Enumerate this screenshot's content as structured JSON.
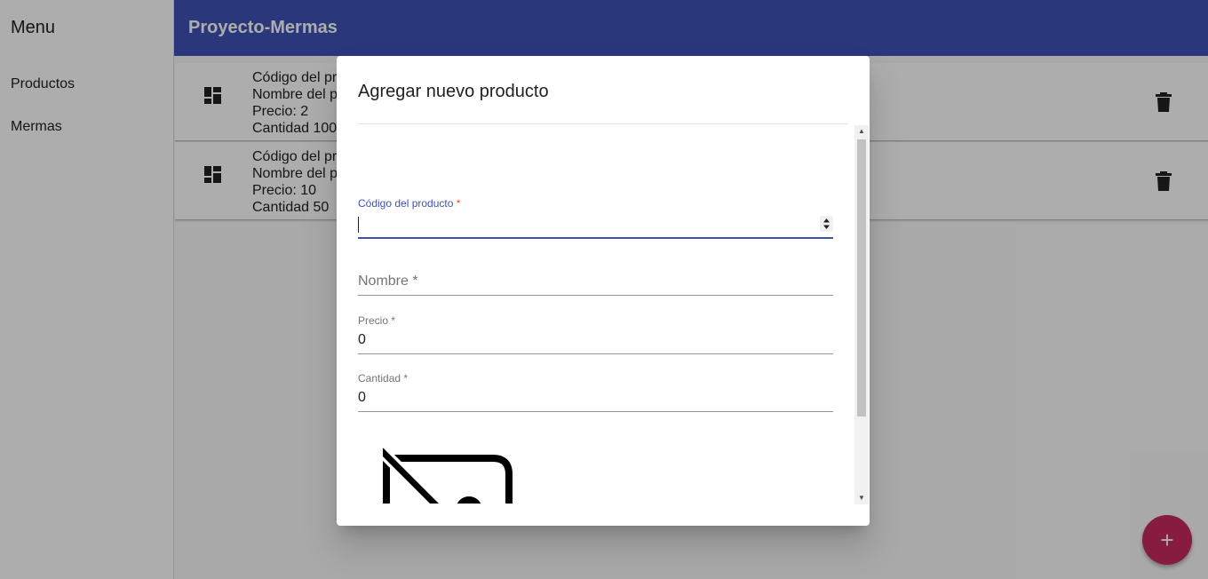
{
  "sidebar": {
    "title": "Menu",
    "items": [
      {
        "label": "Productos"
      },
      {
        "label": "Mermas"
      }
    ]
  },
  "toolbar": {
    "title": "Proyecto-Mermas"
  },
  "products": [
    {
      "icon": "dashboard-icon",
      "code_line": "Código del pr",
      "name_line": "Nombre del p",
      "price_line": "Precio: 2",
      "qty_line": "Cantidad 100"
    },
    {
      "icon": "dashboard-icon",
      "code_line": "Código del pr",
      "name_line": "Nombre del p",
      "price_line": "Precio: 10",
      "qty_line": "Cantidad 50"
    }
  ],
  "dialog": {
    "title": "Agregar nuevo producto",
    "fields": {
      "code": {
        "label": "Código del producto",
        "required_mark": "*",
        "value": ""
      },
      "name": {
        "placeholder": "Nombre *",
        "value": ""
      },
      "price": {
        "label": "Precio *",
        "value": "0"
      },
      "quantity": {
        "label": "Cantidad *",
        "value": "0"
      }
    },
    "image_icon": "hide-image-icon"
  },
  "fab": {
    "label": "+",
    "icon": "add-icon"
  },
  "colors": {
    "primary": "#3f51b5",
    "accent": "#c7285f",
    "warn": "#f44336"
  }
}
